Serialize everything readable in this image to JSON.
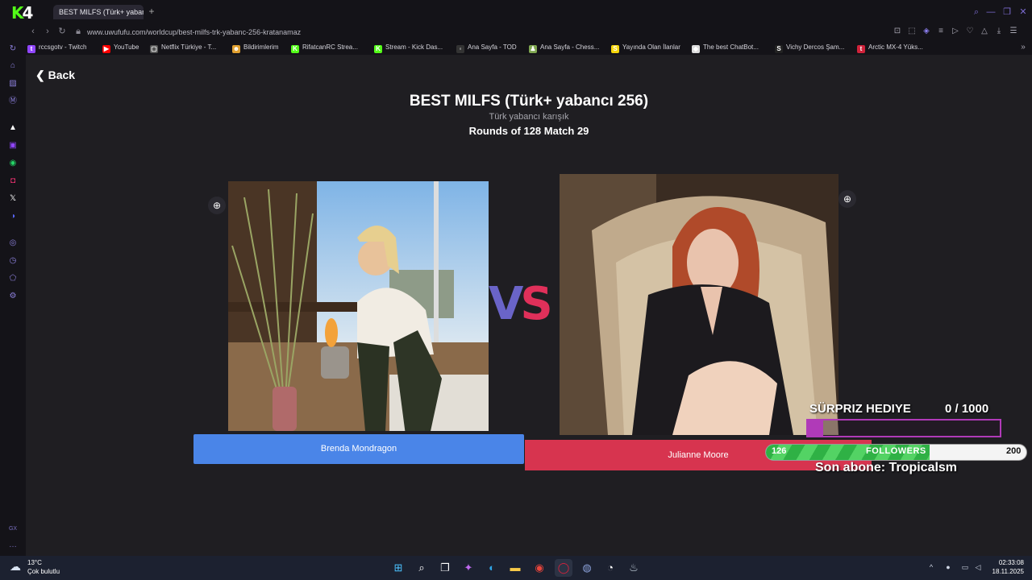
{
  "browser": {
    "logo_k": "K",
    "logo_4": "4",
    "tab_title": "BEST MILFS (Türk+ yaban",
    "tab_new": "+",
    "url": "www.uwufufu.com/worldcup/best-milfs-trk-yabanc-256-kratanamaz",
    "bookmarks": [
      {
        "label": "rccsgotv - Twitch",
        "icon_color": "#9146ff",
        "glyph": "t"
      },
      {
        "label": "YouTube",
        "icon_color": "#ff0000",
        "glyph": "▶"
      },
      {
        "label": "Netflix Türkiye - T...",
        "icon_color": "#555555",
        "glyph": "▢"
      },
      {
        "label": "Bildirimlerim",
        "icon_color": "#e0a030",
        "glyph": "☻"
      },
      {
        "label": "RifatcanRC Strea...",
        "icon_color": "#53fc18",
        "glyph": "K"
      },
      {
        "label": "Stream - Kick Das...",
        "icon_color": "#53fc18",
        "glyph": "K"
      },
      {
        "label": "Ana Sayfa - TOD",
        "icon_color": "#333333",
        "glyph": "◦"
      },
      {
        "label": "Ana Sayfa - Chess...",
        "icon_color": "#7fa650",
        "glyph": "♟"
      },
      {
        "label": "Yayında Olan İlanlar",
        "icon_color": "#f5d60a",
        "glyph": "S"
      },
      {
        "label": "The best ChatBot...",
        "icon_color": "#dddddd",
        "glyph": "◆"
      },
      {
        "label": "Vichy Dercos Şam...",
        "icon_color": "#222222",
        "glyph": "S"
      },
      {
        "label": "Arctic MX-4 Yüks...",
        "icon_color": "#d0223a",
        "glyph": "t"
      }
    ]
  },
  "page": {
    "back_label": "Back",
    "title": "BEST MILFS (Türk+ yabancı 256)",
    "subtitle": "Türk yabancı karışık",
    "round": "Rounds of 128 Match 29",
    "vs_v": "V",
    "vs_s": "S",
    "left_name": "Brenda Mondragon",
    "right_name": "Julianne Moore"
  },
  "overlay": {
    "gift_label": "SÜRPRIZ HEDIYE",
    "gift_count": "0  / 1000",
    "gift_progress": 0.08,
    "followers_label": "FOLLOWERS",
    "followers_current": "126",
    "followers_goal": "200",
    "followers_progress": 0.63,
    "last_sub": "Son abone: Tropicalsm"
  },
  "taskbar": {
    "temp": "13°C",
    "weather": "Çok bulutlu",
    "time": "02:33:08",
    "date": "18.11.2025"
  },
  "colors": {
    "accent_blue": "#4a85e8",
    "accent_red": "#d7344f",
    "kick_green": "#53fc18",
    "gift_purple": "#b03ab8"
  }
}
